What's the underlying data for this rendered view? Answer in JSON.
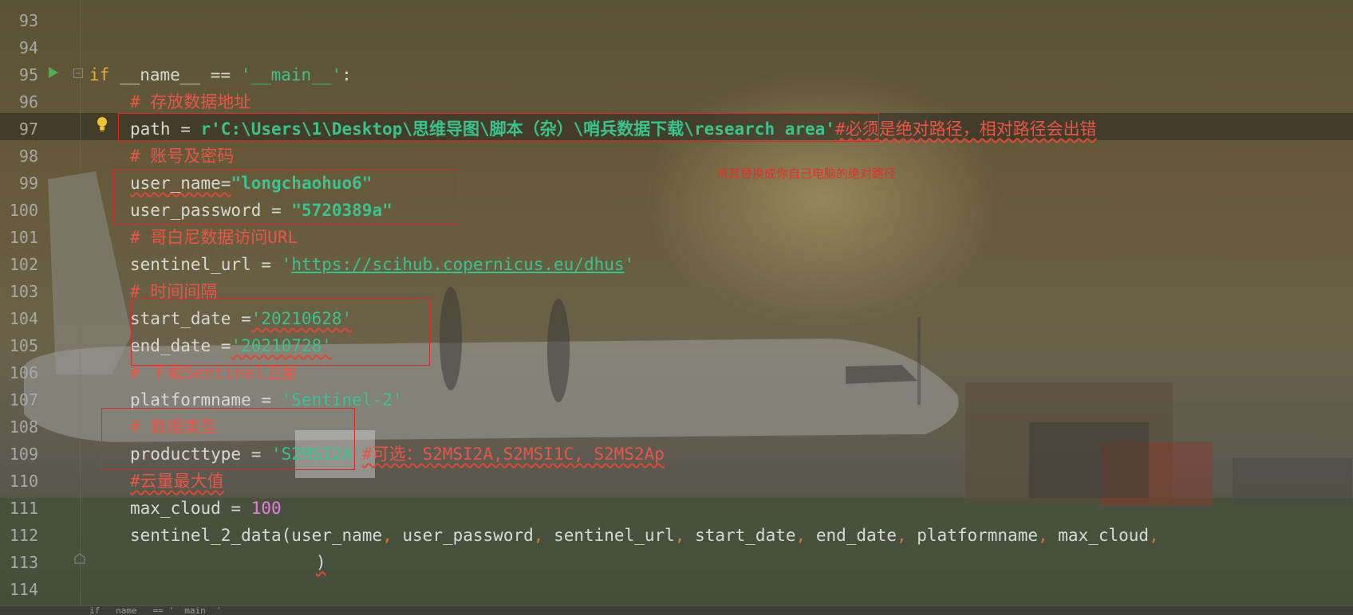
{
  "editor": {
    "line_numbers": [
      "93",
      "94",
      "95",
      "96",
      "97",
      "98",
      "99",
      "100",
      "101",
      "102",
      "103",
      "104",
      "105",
      "106",
      "107",
      "108",
      "109",
      "110",
      "111",
      "112",
      "113",
      "114"
    ],
    "code": {
      "l95": {
        "if": "if",
        "name_expr": " __name__ == ",
        "main_str": "'__main__'",
        "colon": ":"
      },
      "l96": "# 存放数据地址",
      "l97": {
        "var": "path = ",
        "value": "r'C:\\Users\\1\\Desktop\\思维导图\\脚本（杂）\\哨兵数据下载\\research area'",
        "comment": "#必须是绝对路径，相对路径会出错"
      },
      "l98": "# 账号及密码",
      "l99": {
        "var": "user_name=",
        "value": "\"longchaohuo6\""
      },
      "l100": {
        "var": "user_password = ",
        "value": "\"5720389a\""
      },
      "l101": "# 哥白尼数据访问URL",
      "l102": {
        "var": "sentinel_url = ",
        "q1": "'",
        "url": "https://scihub.copernicus.eu/dhus",
        "q2": "'"
      },
      "l103": "# 时间间隔",
      "l104": {
        "var": "start_date =",
        "value": "'20210628'"
      },
      "l105": {
        "var": "end_date =",
        "value": "'20210728'"
      },
      "l106": "# 下载Sentinel卫星",
      "l107": {
        "var": "platformname = ",
        "value": "'Sentinel-2'"
      },
      "l108": "# 数据类型",
      "l109": {
        "var": "producttype = ",
        "value": "'S2MSI2A'",
        "comment": "#可选：S2MSI2A,S2MSI1C, S2MS2Ap"
      },
      "l110": "#云量最大值",
      "l111": {
        "var": "max_cloud = ",
        "value": "100"
      },
      "l112": {
        "fn": "sentinel_2_data(",
        "args": [
          "user_name",
          "user_password",
          "sentinel_url",
          "start_date",
          "end_date",
          "platformname",
          "max_cloud"
        ],
        "sep": ", ",
        "trail": ","
      },
      "l113": ")"
    },
    "annotation_note": "将其替换成你自己电脑的绝对路径",
    "status_text": "if __name__ == '__main__'"
  },
  "colors": {
    "keyword": "#e8a83a",
    "string": "#3cc28d",
    "comment": "#e8564a",
    "number": "#e57de0",
    "highlight_box": "#d42a2a"
  },
  "icons": {
    "run": "run-icon",
    "fold": "fold-icon",
    "fold_end": "fold-end-icon",
    "bulb": "lightbulb-icon"
  }
}
